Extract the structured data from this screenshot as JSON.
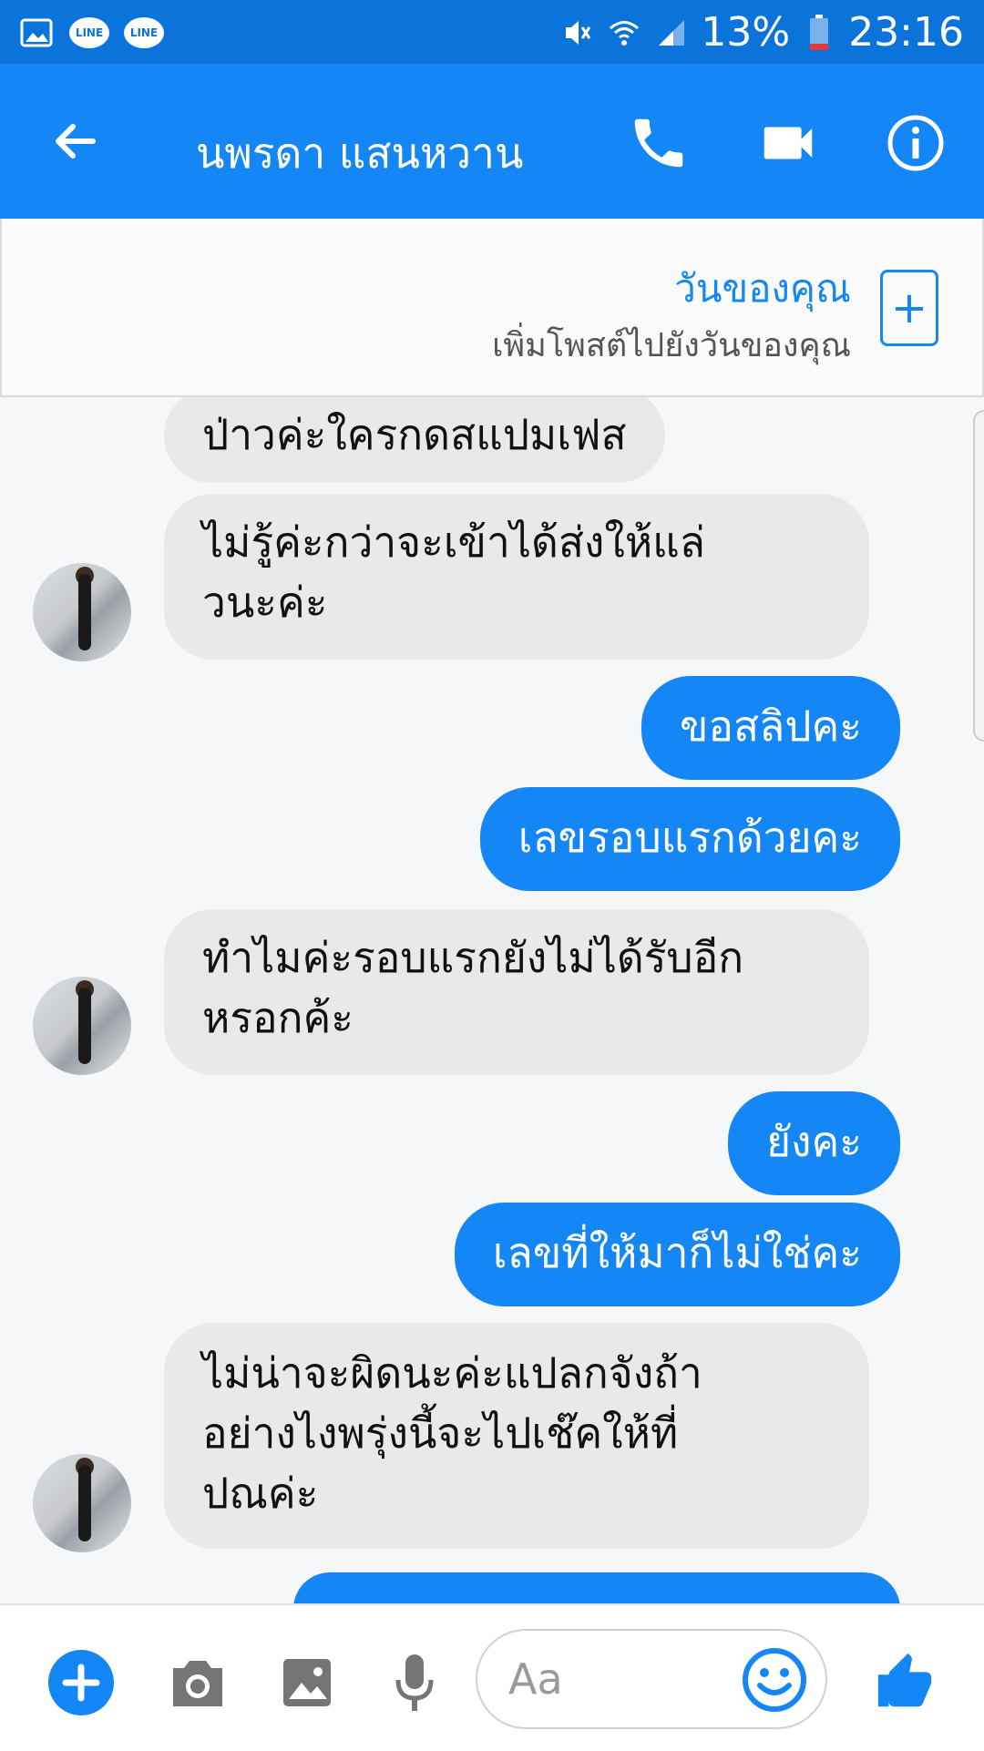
{
  "status_bar": {
    "battery": "13%",
    "time": "23:16"
  },
  "header": {
    "contact_name": "นพรดา แสนหวาน"
  },
  "your_day": {
    "title": "วันของคุณ",
    "subtitle": "เพิ่มโพสต์ไปยังวันของคุณ"
  },
  "messages": [
    {
      "side": "in",
      "lines": [
        "ป่าวค่ะใครกดสแปมเฟส"
      ]
    },
    {
      "side": "in",
      "lines": [
        "ไม่รู้ค่ะกว่าจะเข้าได้ส่งให้แล่",
        "วนะค่ะ"
      ]
    },
    {
      "side": "out",
      "lines": [
        "ขอสลิปคะ"
      ]
    },
    {
      "side": "out",
      "lines": [
        "เลขรอบแรกด้วยคะ"
      ]
    },
    {
      "side": "in",
      "lines": [
        "ทำไมค่ะรอบแรกยังไม่ได้รับอีก",
        "หรอกค้ะ"
      ]
    },
    {
      "side": "out",
      "lines": [
        "ยังคะ"
      ]
    },
    {
      "side": "out",
      "lines": [
        "เลขที่ให้มาก็ไม่ใช่คะ"
      ]
    },
    {
      "side": "in",
      "lines": [
        "ไม่น่าจะผิดนะค่ะแปลกจังถ้า",
        "อย่างไงพรุ่งนี้จะไปเช๊คให้ที่",
        "ปณค่ะ"
      ]
    }
  ],
  "composer": {
    "placeholder": "Aa"
  },
  "colors": {
    "brand": "#1486f6",
    "status_bar": "#0b74db",
    "incoming_bubble": "#e9e9ea"
  },
  "icons": [
    "gallery-icon",
    "line-icon",
    "mute-icon",
    "wifi-icon",
    "signal-icon",
    "battery-icon",
    "back-arrow-icon",
    "phone-icon",
    "video-icon",
    "info-icon",
    "plus-icon",
    "camera-icon",
    "image-icon",
    "mic-icon",
    "emoji-icon",
    "like-icon"
  ]
}
